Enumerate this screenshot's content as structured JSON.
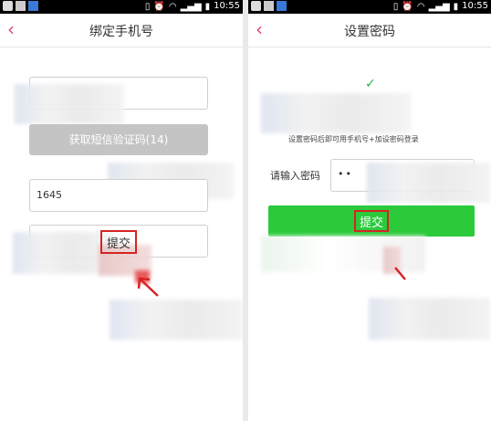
{
  "status_bar": {
    "time": "10:55"
  },
  "screen_left": {
    "title": "绑定手机号",
    "sms_button_label": "获取短信验证码(14)",
    "code_value": "1645",
    "submit_label": "提交"
  },
  "screen_right": {
    "title": "设置密码",
    "hint_text": "设置密码后即可用手机号+加设密码登录",
    "password_label": "请输入密码",
    "password_value": "••",
    "submit_label": "提交"
  },
  "colors": {
    "accent_back": "#d34c6a",
    "submit_green": "#2bca3b",
    "highlight_red": "#d52424",
    "disabled_gray": "#c4c4c4"
  },
  "icons": {
    "back": "chevron-left-icon",
    "check": "check-icon"
  }
}
